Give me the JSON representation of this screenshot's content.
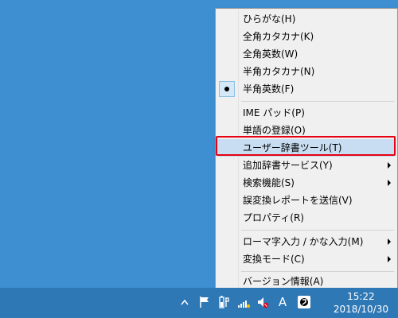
{
  "menu": {
    "items": [
      {
        "label": "ひらがな(H)"
      },
      {
        "label": "全角カタカナ(K)"
      },
      {
        "label": "全角英数(W)"
      },
      {
        "label": "半角カタカナ(N)"
      },
      {
        "label": "半角英数(F)",
        "checked": true
      },
      {
        "label": "IME パッド(P)"
      },
      {
        "label": "単語の登録(O)"
      },
      {
        "label": "ユーザー辞書ツール(T)",
        "highlighted": true
      },
      {
        "label": "追加辞書サービス(Y)",
        "submenu": true
      },
      {
        "label": "検索機能(S)",
        "submenu": true
      },
      {
        "label": "誤変換レポートを送信(V)"
      },
      {
        "label": "プロパティ(R)"
      },
      {
        "label": "ローマ字入力 / かな入力(M)",
        "submenu": true
      },
      {
        "label": "変換モード(C)",
        "submenu": true
      },
      {
        "label": "バージョン情報(A)"
      }
    ]
  },
  "taskbar": {
    "ime_mode": "A",
    "clock": {
      "time": "15:22",
      "date": "2018/10/30"
    }
  },
  "colors": {
    "desktop": "#3d8fd1",
    "taskbar": "#2f78b6",
    "highlight_frame": "#e60012",
    "menu_background": "#f0f0f0"
  }
}
